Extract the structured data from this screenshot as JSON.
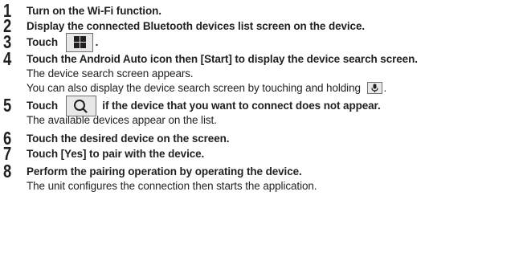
{
  "steps": [
    {
      "number": "1",
      "title": "Turn on the Wi-Fi function.",
      "desc": []
    },
    {
      "number": "2",
      "title": "Display the connected Bluetooth devices list screen on the device.",
      "desc": []
    },
    {
      "number": "3",
      "title_before": "Touch",
      "icon": "app-grid-icon",
      "title_after": ".",
      "desc": []
    },
    {
      "number": "4",
      "title": "Touch the Android Auto icon then [Start] to display the device search screen.",
      "desc": [
        "The device search screen appears.",
        "You can also display the device search screen by touching and holding"
      ],
      "desc_icon": "microphone-icon",
      "desc_after": "."
    },
    {
      "number": "5",
      "title_before": "Touch",
      "icon": "search-icon",
      "title_after": "if the device that you want to connect does not appear.",
      "desc": [
        "The available devices appear on the list."
      ]
    },
    {
      "number": "6",
      "title": "Touch the desired device on the screen.",
      "desc": []
    },
    {
      "number": "7",
      "title": "Touch [Yes] to pair with the device.",
      "desc": []
    },
    {
      "number": "8",
      "title": "Perform the pairing operation by operating the device.",
      "desc": [
        "The unit configures the connection then starts the application."
      ]
    }
  ]
}
